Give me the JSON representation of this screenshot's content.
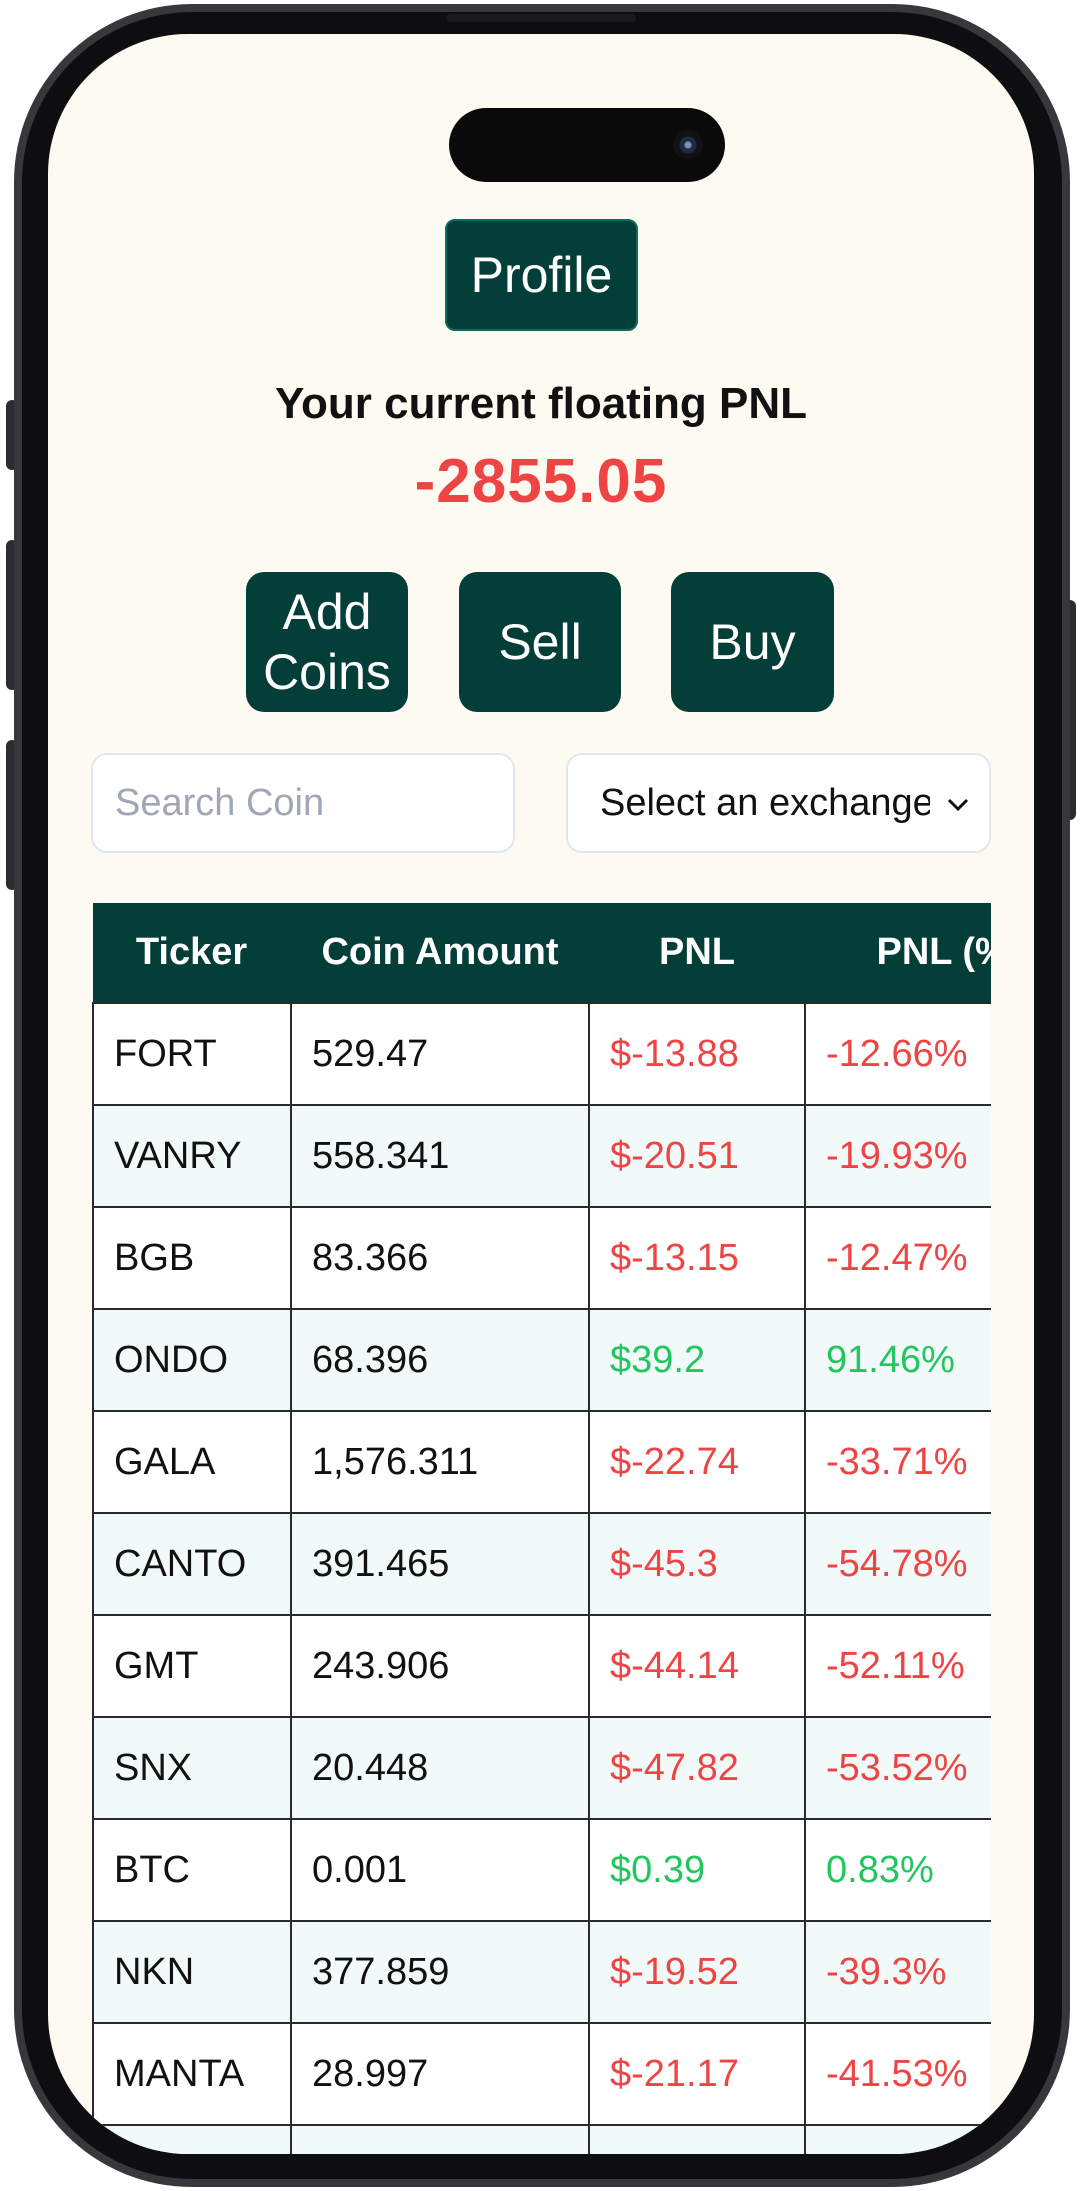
{
  "profile_button": "Profile",
  "pnl": {
    "label": "Your current floating PNL",
    "value": "-2855.05"
  },
  "actions": {
    "add_coins": "Add\nCoins",
    "sell": "Sell",
    "buy": "Buy"
  },
  "search": {
    "placeholder": "Search Coin"
  },
  "exchange_select": {
    "value": "Select an exchange"
  },
  "table": {
    "headers": [
      "Ticker",
      "Coin Amount",
      "PNL",
      "PNL (%)"
    ],
    "rows": [
      {
        "ticker": "FORT",
        "amount": "529.47",
        "pnl": "$-13.88",
        "pct": "-12.66%",
        "sign": "neg"
      },
      {
        "ticker": "VANRY",
        "amount": "558.341",
        "pnl": "$-20.51",
        "pct": "-19.93%",
        "sign": "neg"
      },
      {
        "ticker": "BGB",
        "amount": "83.366",
        "pnl": "$-13.15",
        "pct": "-12.47%",
        "sign": "neg"
      },
      {
        "ticker": "ONDO",
        "amount": "68.396",
        "pnl": "$39.2",
        "pct": "91.46%",
        "sign": "pos"
      },
      {
        "ticker": "GALA",
        "amount": "1,576.311",
        "pnl": "$-22.74",
        "pct": "-33.71%",
        "sign": "neg"
      },
      {
        "ticker": "CANTO",
        "amount": "391.465",
        "pnl": "$-45.3",
        "pct": "-54.78%",
        "sign": "neg"
      },
      {
        "ticker": "GMT",
        "amount": "243.906",
        "pnl": "$-44.14",
        "pct": "-52.11%",
        "sign": "neg"
      },
      {
        "ticker": "SNX",
        "amount": "20.448",
        "pnl": "$-47.82",
        "pct": "-53.52%",
        "sign": "neg"
      },
      {
        "ticker": "BTC",
        "amount": "0.001",
        "pnl": "$0.39",
        "pct": "0.83%",
        "sign": "pos"
      },
      {
        "ticker": "NKN",
        "amount": "377.859",
        "pnl": "$-19.52",
        "pct": "-39.3%",
        "sign": "neg"
      },
      {
        "ticker": "MANTA",
        "amount": "28.997",
        "pnl": "$-21.17",
        "pct": "-41.53%",
        "sign": "neg"
      },
      {
        "ticker": "",
        "amount": "",
        "pnl": "",
        "pct": "",
        "sign": "neg"
      }
    ]
  },
  "colors": {
    "primary": "#033e38",
    "negative": "#ef4444",
    "positive": "#22c55e",
    "background": "#fdfaf1"
  }
}
